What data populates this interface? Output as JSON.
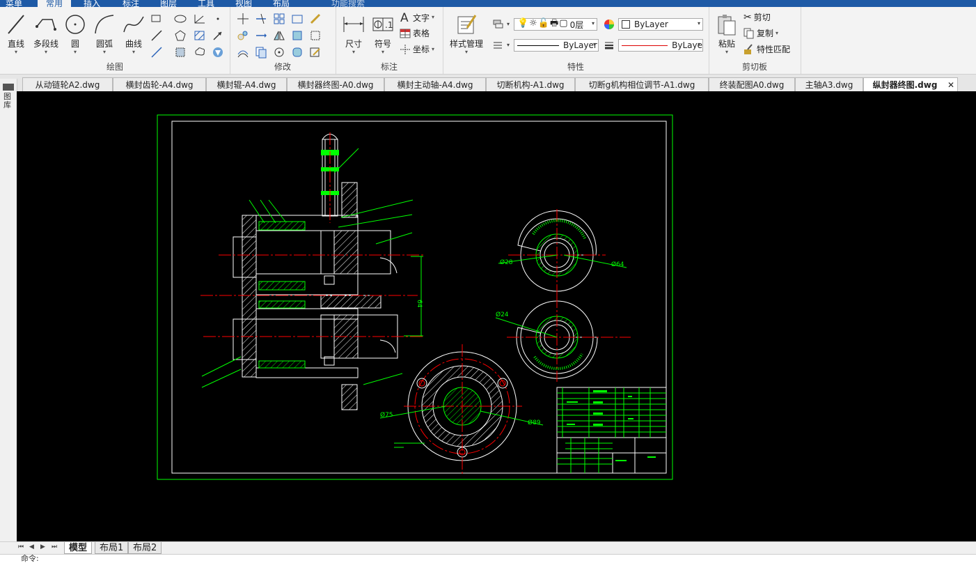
{
  "menu": {
    "items": [
      "菜单",
      "常用",
      "插入",
      "标注",
      "图层",
      "工具",
      "视图",
      "布局"
    ],
    "search_hint": "功能搜索"
  },
  "ribbon": {
    "draw": {
      "title": "绘图",
      "line": "直线",
      "polyline": "多段线",
      "circle": "圆",
      "arc": "圆弧",
      "curve": "曲线"
    },
    "modify": {
      "title": "修改"
    },
    "annotate": {
      "title": "标注",
      "dimension": "尺寸",
      "symbol": "符号",
      "text": "文字",
      "table": "表格",
      "coordinate": "坐标"
    },
    "properties": {
      "title": "特性",
      "style_manager": "样式管理",
      "layer_value": "0层",
      "color_value": "ByLayer",
      "linetype_value": "ByLayer",
      "lineweight_value": "ByLaye"
    },
    "clipboard": {
      "title": "剪切板",
      "paste": "粘贴",
      "cut": "剪切",
      "copy": "复制",
      "match": "特性匹配"
    }
  },
  "tabs": [
    "从动链轮A2.dwg",
    "横封齿轮-A4.dwg",
    "横封辊-A4.dwg",
    "横封器终图-A0.dwg",
    "横封主动轴-A4.dwg",
    "切断机构-A1.dwg",
    "切断g机构相位调节-A1.dwg",
    "终装配图A0.dwg",
    "主轴A3.dwg",
    "纵封器终图.dwg"
  ],
  "left_panel_label": "图库",
  "drawing": {
    "dim_64_label": "64",
    "dia_28": "Ø28",
    "dia_64": "Ø64",
    "dia_24": "Ø24",
    "dia_75": "Ø75",
    "dia_89": "Ø89"
  },
  "layout_tabs": [
    "模型",
    "布局1",
    "布局2"
  ],
  "command_prompt": "命令:"
}
